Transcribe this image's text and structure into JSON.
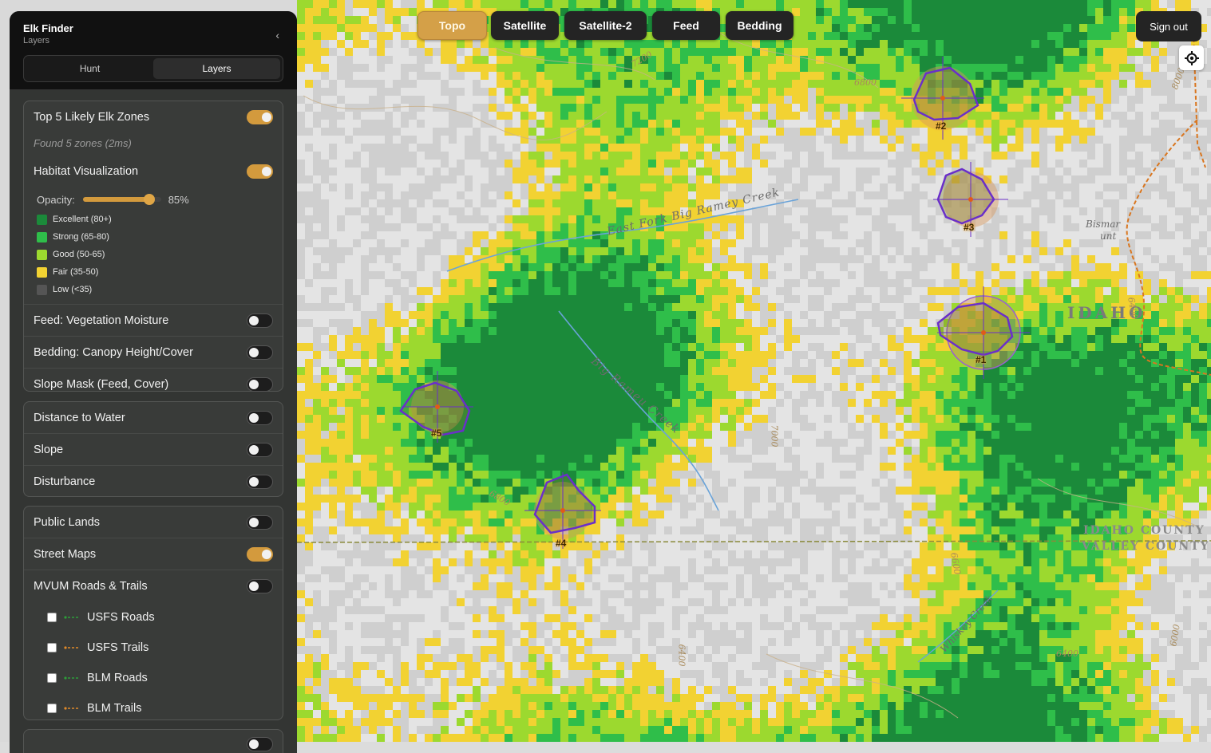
{
  "app": {
    "title": "Elk Finder",
    "subtitle": "Layers"
  },
  "tabs": [
    {
      "label": "Hunt",
      "active": false
    },
    {
      "label": "Layers",
      "active": true
    }
  ],
  "groups": {
    "habitat": {
      "top5": {
        "label": "Top 5 Likely Elk Zones",
        "on": true,
        "note": "Found 5 zones (2ms)"
      },
      "habitat_viz": {
        "label": "Habitat Visualization",
        "on": true
      },
      "opacity": {
        "label": "Opacity:",
        "value": 0.85,
        "display": "85%"
      },
      "legend": [
        {
          "label": "Excellent (80+)",
          "color": "#1b8a3a"
        },
        {
          "label": "Strong (65-80)",
          "color": "#2fbe4a"
        },
        {
          "label": "Good (50-65)",
          "color": "#9cd92f"
        },
        {
          "label": "Fair (35-50)",
          "color": "#f2d232"
        },
        {
          "label": "Low (<35)",
          "color": "#555555"
        }
      ],
      "feed": {
        "label": "Feed: Vegetation Moisture",
        "on": false
      },
      "bedding": {
        "label": "Bedding: Canopy Height/Cover",
        "on": false
      },
      "slope_mask": {
        "label": "Slope Mask (Feed, Cover)",
        "on": false
      }
    },
    "terrain": {
      "water": {
        "label": "Distance to Water",
        "on": false
      },
      "slope": {
        "label": "Slope",
        "on": false
      },
      "disturbance": {
        "label": "Disturbance",
        "on": false
      }
    },
    "overlays": {
      "public_lands": {
        "label": "Public Lands",
        "on": false
      },
      "street_maps": {
        "label": "Street Maps",
        "on": true
      },
      "mvum": {
        "label": "MVUM Roads & Trails",
        "on": false
      },
      "layers": [
        {
          "label": "USFS Roads",
          "color": "#2e9e3a",
          "checked": false
        },
        {
          "label": "USFS Trails",
          "color": "#e08a2a",
          "checked": false
        },
        {
          "label": "BLM Roads",
          "color": "#2e9e3a",
          "checked": false
        },
        {
          "label": "BLM Trails",
          "color": "#e08a2a",
          "checked": false
        }
      ]
    }
  },
  "map_buttons": [
    {
      "label": "Topo",
      "active": true
    },
    {
      "label": "Satellite",
      "active": false
    },
    {
      "label": "Satellite-2",
      "active": false
    },
    {
      "label": "Feed",
      "active": false
    },
    {
      "label": "Bedding",
      "active": false
    }
  ],
  "sign_out": "Sign out",
  "locate_icon": "crosshair-locate-icon",
  "map_labels": {
    "creek1": "East Fork Big Ramey Creek",
    "creek2": "Big Rameu Creek",
    "creek3": "Whiskey Creek",
    "state": "IDAHO",
    "county1": "IDAHO COUNTY",
    "county2": "VALLEY COUNTY",
    "bismar": "Bismar",
    "bismar2": "unt",
    "contours": [
      "7200",
      "6800",
      "8000",
      "7000",
      "6800",
      "6400",
      "6600",
      "6400",
      "6000",
      "6400"
    ]
  },
  "zones": [
    "#1",
    "#2",
    "#3",
    "#4",
    "#5"
  ]
}
